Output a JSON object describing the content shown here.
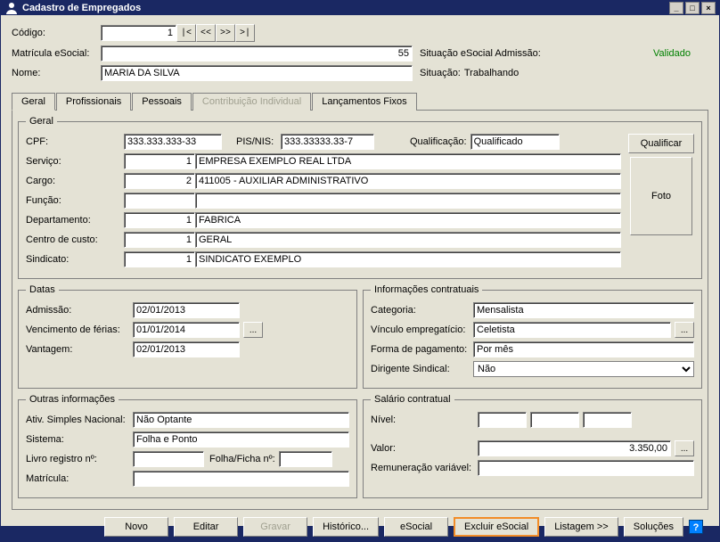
{
  "window": {
    "title": "Cadastro de Empregados",
    "min": "_",
    "max": "□",
    "close": "×"
  },
  "header": {
    "codigo_lbl": "Código:",
    "codigo_val": "1",
    "nav_first": "|<",
    "nav_prev": "<<",
    "nav_next": ">>",
    "nav_last": ">|",
    "matricula_lbl": "Matrícula eSocial:",
    "matricula_val": "55",
    "sit_esocial_lbl": "Situação eSocial Admissão:",
    "sit_esocial_val": "Validado",
    "nome_lbl": "Nome:",
    "nome_val": "MARIA DA SILVA",
    "situacao_lbl": "Situação:",
    "situacao_val": "Trabalhando"
  },
  "tabs": {
    "geral": "Geral",
    "profissionais": "Profissionais",
    "pessoais": "Pessoais",
    "contrib": "Contribuição Individual",
    "lanc": "Lançamentos Fixos"
  },
  "geral": {
    "legend": "Geral",
    "cpf_lbl": "CPF:",
    "cpf_val": "333.333.333-33",
    "pisnis_lbl": "PIS/NIS:",
    "pisnis_val": "333.33333.33-7",
    "qualif_lbl": "Qualificação:",
    "qualif_val": "Qualificado",
    "qualificar_btn": "Qualificar",
    "foto_lbl": "Foto",
    "servico_lbl": "Serviço:",
    "servico_code": "1",
    "servico_val": "EMPRESA EXEMPLO REAL LTDA",
    "cargo_lbl": "Cargo:",
    "cargo_code": "2",
    "cargo_val": "411005 - AUXILIAR ADMINISTRATIVO",
    "funcao_lbl": "Função:",
    "funcao_code": "",
    "funcao_val": "",
    "depto_lbl": "Departamento:",
    "depto_code": "1",
    "depto_val": "FABRICA",
    "cc_lbl": "Centro de custo:",
    "cc_code": "1",
    "cc_val": "GERAL",
    "sind_lbl": "Sindicato:",
    "sind_code": "1",
    "sind_val": "SINDICATO EXEMPLO"
  },
  "datas": {
    "legend": "Datas",
    "admissao_lbl": "Admissão:",
    "admissao_val": "02/01/2013",
    "vferias_lbl": "Vencimento de férias:",
    "vferias_val": "01/01/2014",
    "vant_lbl": "Vantagem:",
    "vant_val": "02/01/2013",
    "more": "..."
  },
  "infocontr": {
    "legend": "Informações contratuais",
    "categoria_lbl": "Categoria:",
    "categoria_val": "Mensalista",
    "vinculo_lbl": "Vínculo empregatício:",
    "vinculo_val": "Celetista",
    "forma_lbl": "Forma de pagamento:",
    "forma_val": "Por mês",
    "dirigente_lbl": "Dirigente Sindical:",
    "dirigente_val": "Não",
    "more": "..."
  },
  "outras": {
    "legend": "Outras informações",
    "simples_lbl": "Ativ. Simples Nacional:",
    "simples_val": "Não Optante",
    "sistema_lbl": "Sistema:",
    "sistema_val": "Folha e Ponto",
    "livro_lbl": "Livro registro nº:",
    "livro_val": "",
    "folha_lbl": "Folha/Ficha nº:",
    "folha_val": "",
    "matricula_lbl": "Matrícula:",
    "matricula_val": ""
  },
  "salario": {
    "legend": "Salário contratual",
    "nivel_lbl": "Nível:",
    "valor_lbl": "Valor:",
    "valor_val": "3.350,00",
    "remvar_lbl": "Remuneração variável:",
    "remvar_val": "",
    "more": "..."
  },
  "buttons": {
    "novo": "Novo",
    "editar": "Editar",
    "gravar": "Gravar",
    "historico": "Histórico...",
    "esocial": "eSocial",
    "excluir_esocial": "Excluir eSocial",
    "listagem": "Listagem >>",
    "solucoes": "Soluções",
    "help": "?"
  }
}
